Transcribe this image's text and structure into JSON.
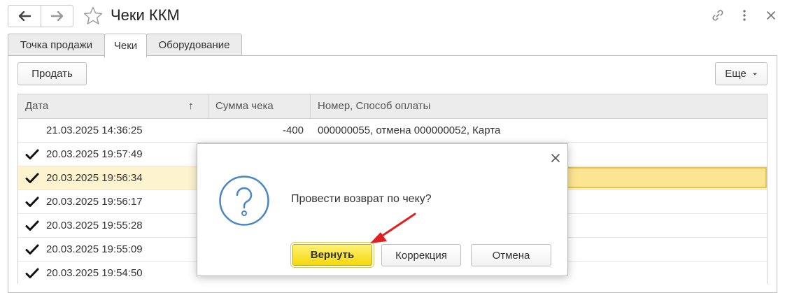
{
  "window": {
    "title": "Чеки ККМ"
  },
  "tabs": [
    {
      "label": "Точка продажи"
    },
    {
      "label": "Чеки"
    },
    {
      "label": "Оборудование"
    }
  ],
  "toolbar": {
    "sell_label": "Продать",
    "more_label": "Еще"
  },
  "table": {
    "columns": [
      {
        "label": "Дата",
        "sort": "↑"
      },
      {
        "label": "Сумма чека"
      },
      {
        "label": "Номер, Способ оплаты"
      }
    ],
    "rows": [
      {
        "checked": false,
        "date": "21.03.2025 14:36:25",
        "sum": "-400",
        "info": "000000055, отмена 000000052, Карта"
      },
      {
        "checked": true,
        "date": "20.03.2025 19:57:49",
        "sum": "",
        "info": ""
      },
      {
        "checked": true,
        "date": "20.03.2025 19:56:34",
        "sum": "",
        "info": "",
        "selected": true
      },
      {
        "checked": true,
        "date": "20.03.2025 19:56:17",
        "sum": "",
        "info": ""
      },
      {
        "checked": true,
        "date": "20.03.2025 19:55:28",
        "sum": "",
        "info": ""
      },
      {
        "checked": true,
        "date": "20.03.2025 19:55:09",
        "sum": "",
        "info": ""
      },
      {
        "checked": true,
        "date": "20.03.2025 19:54:50",
        "sum": "",
        "info": ""
      }
    ]
  },
  "dialog": {
    "message": "Провести возврат по чеку?",
    "buttons": {
      "return_label": "Вернуть",
      "correction_label": "Коррекция",
      "cancel_label": "Отмена"
    }
  },
  "colors": {
    "accent_yellow": "#f5d90a",
    "selected_row": "#fdf4cf",
    "question_icon": "#4a86c5",
    "arrow": "#e02020"
  }
}
